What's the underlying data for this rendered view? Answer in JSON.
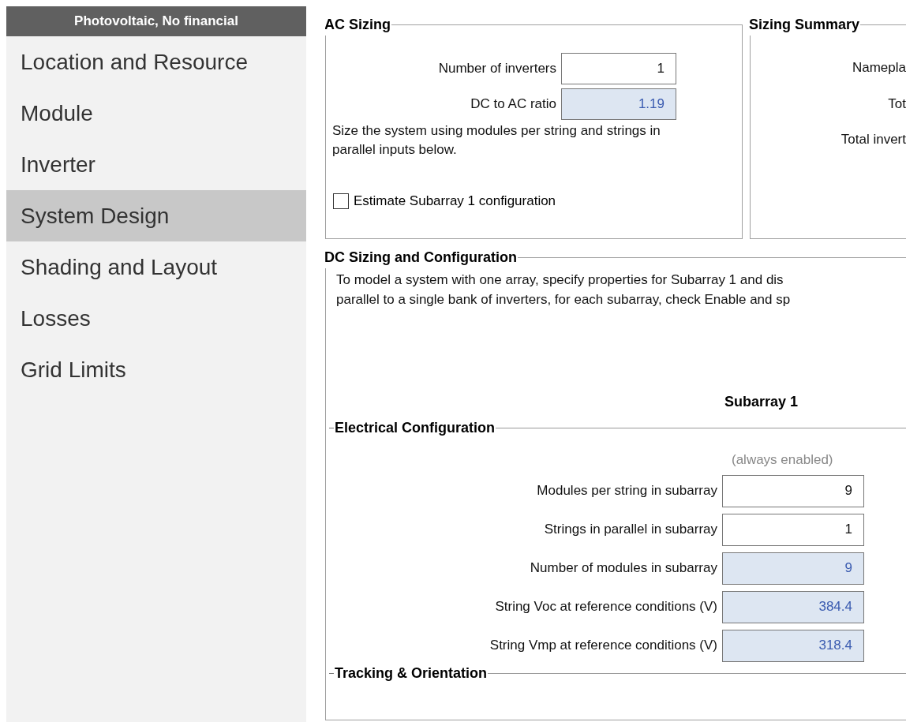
{
  "sidebar": {
    "header": "Photovoltaic, No financial",
    "items": [
      {
        "label": "Location and Resource",
        "selected": false
      },
      {
        "label": "Module",
        "selected": false
      },
      {
        "label": "Inverter",
        "selected": false
      },
      {
        "label": "System Design",
        "selected": true
      },
      {
        "label": "Shading and Layout",
        "selected": false
      },
      {
        "label": "Losses",
        "selected": false
      },
      {
        "label": "Grid Limits",
        "selected": false
      }
    ]
  },
  "ac_sizing": {
    "title": "AC Sizing",
    "fields": [
      {
        "label": "Number of inverters",
        "value": "1",
        "kind": "input"
      },
      {
        "label": "DC to AC ratio",
        "value": "1.19",
        "kind": "calculated"
      }
    ],
    "note": "Size the system using modules per string and strings in parallel inputs below.",
    "checkbox": {
      "label": "Estimate Subarray 1 configuration",
      "checked": false
    }
  },
  "sizing_summary": {
    "title": "Sizing Summary",
    "labels": [
      "Namepla",
      "Tot",
      "Total invert"
    ]
  },
  "dc_sizing": {
    "title": "DC Sizing and Configuration",
    "description_lines": [
      "To model a system with one array, specify properties for Subarray 1 and dis",
      "parallel to a single bank of inverters, for each subarray, check Enable and sp"
    ],
    "subarray_heading": "Subarray 1",
    "electrical": {
      "title": "Electrical Configuration",
      "status": "(always enabled)",
      "fields": [
        {
          "label": "Modules per string in subarray",
          "value": "9",
          "kind": "input"
        },
        {
          "label": "Strings in parallel in subarray",
          "value": "1",
          "kind": "input"
        },
        {
          "label": "Number of modules in subarray",
          "value": "9",
          "kind": "calculated"
        },
        {
          "label": "String Voc at reference conditions (V)",
          "value": "384.4",
          "kind": "calculated"
        },
        {
          "label": "String Vmp at reference conditions (V)",
          "value": "318.4",
          "kind": "calculated"
        }
      ]
    },
    "tracking": {
      "title": "Tracking & Orientation"
    }
  }
}
